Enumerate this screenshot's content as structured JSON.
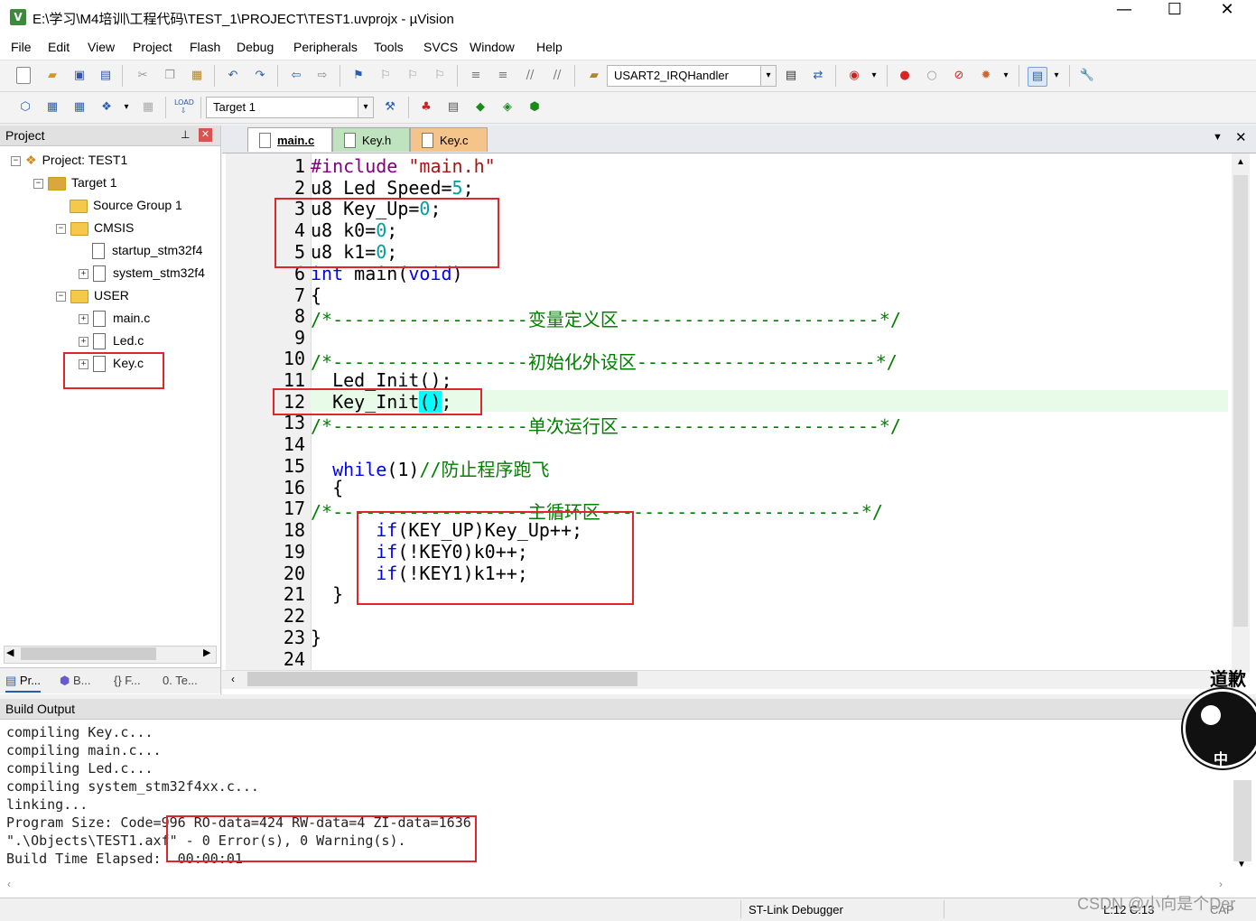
{
  "window": {
    "title": "E:\\学习\\M4培训\\工程代码\\TEST_1\\PROJECT\\TEST1.uvprojx - µVision",
    "app_icon": "μVision-icon",
    "minimize": "—",
    "maximize": "☐",
    "close": "✕"
  },
  "menu": [
    "File",
    "Edit",
    "View",
    "Project",
    "Flash",
    "Debug",
    "Peripherals",
    "Tools",
    "SVCS",
    "Window",
    "Help"
  ],
  "toolbar1": {
    "function_combo_value": "USART2_IRQHandler"
  },
  "toolbar2": {
    "target_combo_value": "Target 1",
    "load_label": "LOAD"
  },
  "project_pane": {
    "title": "Project",
    "tree": [
      {
        "label": "Project: TEST1",
        "icon": "project-icon"
      },
      {
        "label": "Target 1",
        "icon": "target-icon"
      },
      {
        "label": "Source Group 1",
        "icon": "folder-icon"
      },
      {
        "label": "CMSIS",
        "icon": "folder-icon"
      },
      {
        "label": "startup_stm32f4",
        "icon": "file-icon"
      },
      {
        "label": "system_stm32f4",
        "icon": "file-icon"
      },
      {
        "label": "USER",
        "icon": "folder-icon"
      },
      {
        "label": "main.c",
        "icon": "file-icon"
      },
      {
        "label": "Led.c",
        "icon": "file-icon"
      },
      {
        "label": "Key.c",
        "icon": "file-icon"
      }
    ],
    "bottom_tabs": [
      "Pr...",
      "B...",
      "{} F...",
      "0. Te..."
    ]
  },
  "editor": {
    "tabs": [
      {
        "label": "main.c",
        "active": true
      },
      {
        "label": "Key.h",
        "active": false
      },
      {
        "label": "Key.c",
        "active": false
      }
    ],
    "line_numbers": [
      "1",
      "2",
      "3",
      "4",
      "5",
      "6",
      "7",
      "8",
      "9",
      "10",
      "11",
      "12",
      "13",
      "14",
      "15",
      "16",
      "17",
      "18",
      "19",
      "20",
      "21",
      "22",
      "23",
      "24"
    ],
    "code": {
      "l1_pp": "#include",
      "l1_str": "\"main.h\"",
      "l2_a": "u8 Led_Speed=",
      "l2_num": "5",
      "l2_b": ";",
      "l3_a": "u8 Key_Up=",
      "l3_num": "0",
      "l3_b": ";",
      "l4_a": "u8 k0=",
      "l4_num": "0",
      "l4_b": ";",
      "l5_a": "u8 k1=",
      "l5_num": "0",
      "l5_b": ";",
      "l6_kw1": "int",
      "l6_mid": " main(",
      "l6_kw2": "void",
      "l6_end": ")",
      "l7": "{",
      "l8_cmt": "/*------------------变量定义区------------------------*/",
      "l10_cmt": "/*------------------初始化外设区----------------------*/",
      "l11": "  Led_Init();",
      "l12_a": "  Key_Init",
      "l12_hl": "()",
      "l12_b": ";",
      "l13_cmt": "/*------------------单次运行区------------------------*/",
      "l15_kw": "while",
      "l15_mid": "(1)",
      "l15_cmt": "//防止程序跑飞",
      "l16": "  {",
      "l17_cmt": "/*------------------主循环区------------------------*/",
      "l18_kw": "if",
      "l18_rest": "(KEY_UP)Key_Up++;",
      "l19_kw": "if",
      "l19_rest": "(!KEY0)k0++;",
      "l20_kw": "if",
      "l20_rest": "(!KEY1)k1++;",
      "l21": "  }",
      "l23": "}"
    }
  },
  "build_output": {
    "title": "Build Output",
    "lines": [
      "compiling Key.c...",
      "compiling main.c...",
      "compiling Led.c...",
      "compiling system_stm32f4xx.c...",
      "linking...",
      "Program Size: Code=996 RO-data=424 RW-data=4 ZI-data=1636",
      "\".\\Objects\\TEST1.axf\" - 0 Error(s), 0 Warning(s).",
      "Build Time Elapsed:  00:00:01"
    ]
  },
  "status_bar": {
    "debugger": "ST-Link Debugger",
    "position": "L:12 C:13",
    "caps": "CAP"
  },
  "watermark": "CSDN @小向是个Der",
  "sticker_text": "道歉",
  "sticker_bottom": "中"
}
